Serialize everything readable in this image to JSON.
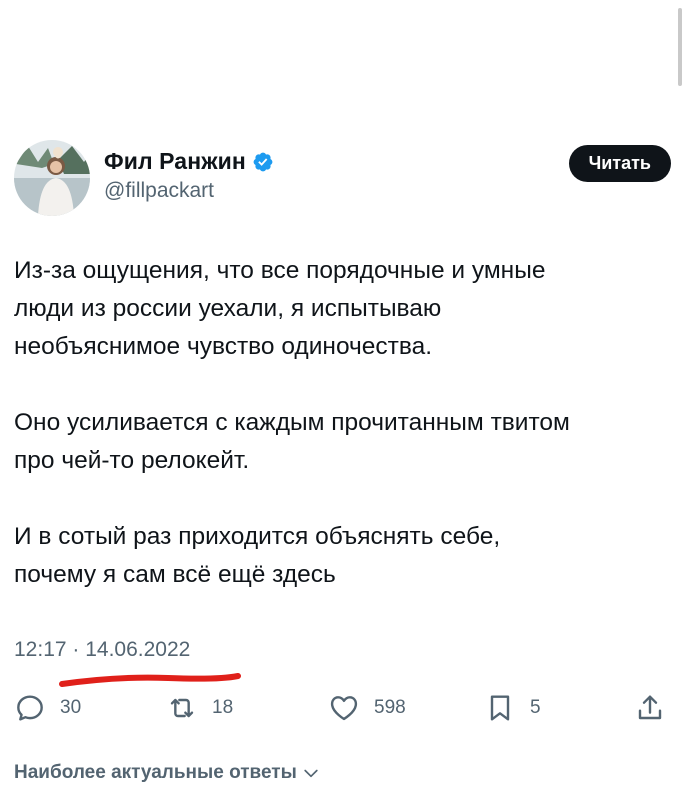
{
  "author": {
    "display_name": "Фил Ранжин",
    "handle": "@fillpackart",
    "verified": true,
    "avatar_icon": "avatar-photo"
  },
  "follow_button": {
    "label": "Читать"
  },
  "tweet": {
    "paragraphs": [
      "Из-за ощущения, что все порядочные и умные\nлюди из россии уехали, я испытываю\nнеобъяснимое чувство одиночества.",
      "Оно усиливается с каждым прочитанным твитом\nпро чей-то релокейт.",
      "И в сотый раз приходится объяснять себе,\nпочему я сам всё ещё здесь"
    ],
    "timestamp": "12:17 · 14.06.2022"
  },
  "actions": {
    "replies": {
      "icon": "reply-icon",
      "count": "30"
    },
    "retweets": {
      "icon": "retweet-icon",
      "count": "18"
    },
    "likes": {
      "icon": "heart-icon",
      "count": "598"
    },
    "bookmarks": {
      "icon": "bookmark-icon",
      "count": "5"
    },
    "share": {
      "icon": "share-icon"
    }
  },
  "replies_sort": {
    "label": "Наиболее актуальные ответы"
  },
  "colors": {
    "text": "#0f1419",
    "secondary": "#536471",
    "verified": "#1d9bf0",
    "button_bg": "#0f1419",
    "annotation": "#e0201a"
  }
}
